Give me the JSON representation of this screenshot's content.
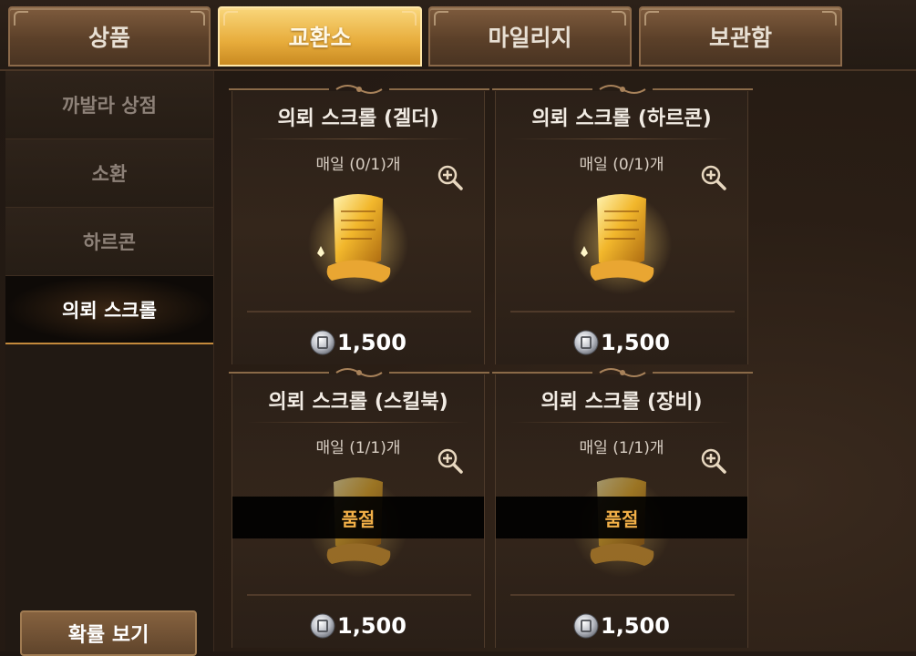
{
  "tabs": [
    {
      "label": "상품",
      "active": false
    },
    {
      "label": "교환소",
      "active": true
    },
    {
      "label": "마일리지",
      "active": false
    },
    {
      "label": "보관함",
      "active": false
    }
  ],
  "sidebar": {
    "items": [
      {
        "label": "까발라 상점",
        "active": false
      },
      {
        "label": "소환",
        "active": false
      },
      {
        "label": "하르콘",
        "active": false
      },
      {
        "label": "의뢰 스크롤",
        "active": true
      }
    ],
    "probability_button": "확률 보기"
  },
  "cards": [
    {
      "title": "의뢰 스크롤 (겔더)",
      "limit": "매일 (0/1)개",
      "price": "1,500",
      "sold_out": false
    },
    {
      "title": "의뢰 스크롤 (하르콘)",
      "limit": "매일 (0/1)개",
      "price": "1,500",
      "sold_out": false
    },
    {
      "title": "의뢰 스크롤 (스킬북)",
      "limit": "매일 (1/1)개",
      "price": "1,500",
      "sold_out": true,
      "sold_out_label": "품절"
    },
    {
      "title": "의뢰 스크롤 (장비)",
      "limit": "매일 (1/1)개",
      "price": "1,500",
      "sold_out": true,
      "sold_out_label": "품절"
    }
  ],
  "icons": {
    "zoom": "zoom-in-icon",
    "coin": "silver-coin-icon",
    "item": "scroll-icon"
  },
  "colors": {
    "accent_gold": "#e7ac3b",
    "sold_out_text": "#f3b048"
  }
}
